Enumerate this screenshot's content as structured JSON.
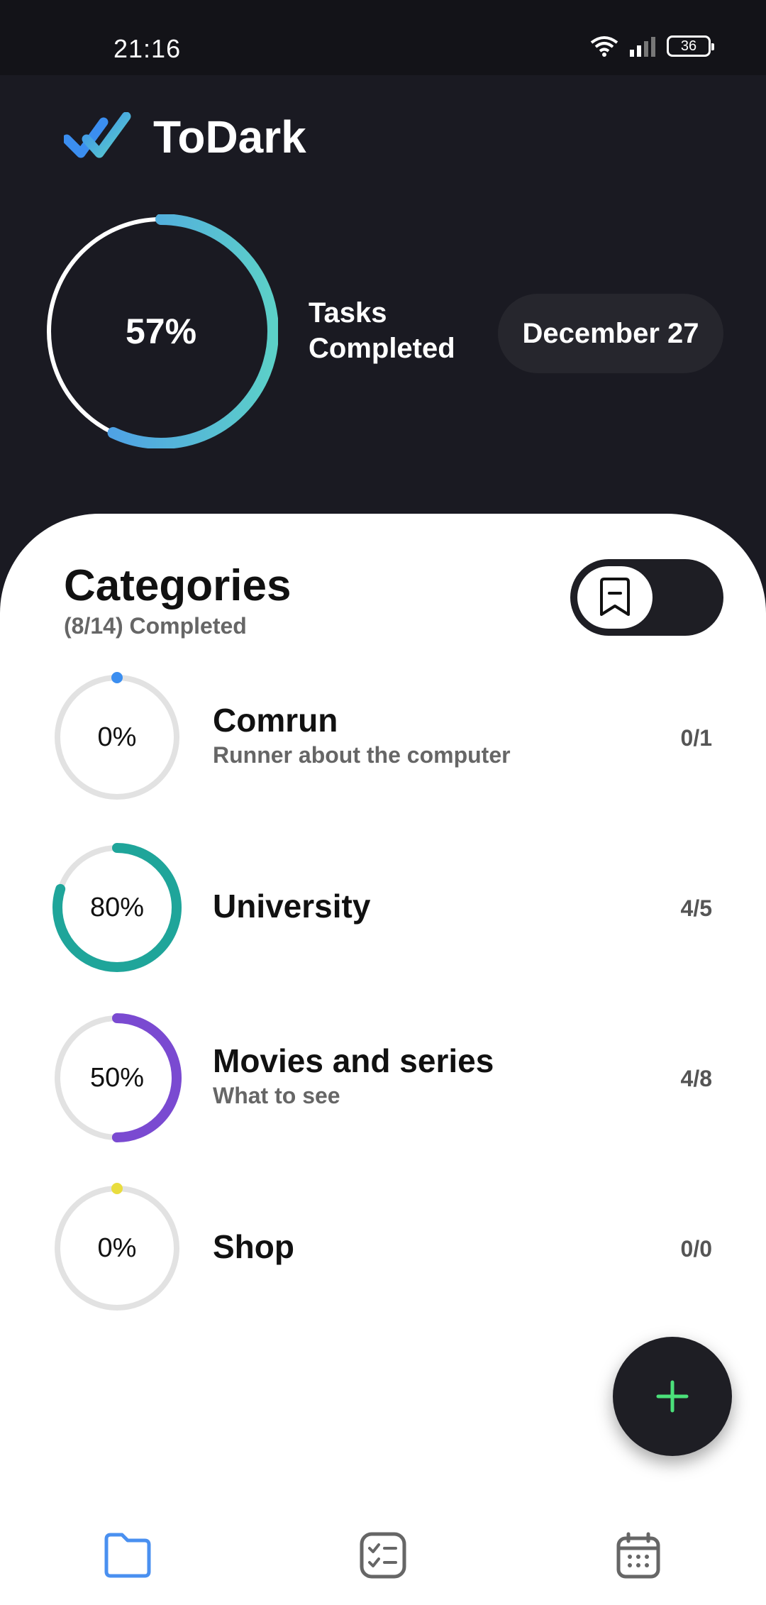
{
  "status_bar": {
    "time": "21:16",
    "battery": "36"
  },
  "app": {
    "title": "ToDark"
  },
  "summary": {
    "percent_label": "57%",
    "completed_fraction": 0.57,
    "tasks_label_1": "Tasks",
    "tasks_label_2": "Completed",
    "date": "December 27"
  },
  "categories": {
    "title": "Categories",
    "subtitle": "(8/14) Completed",
    "items": [
      {
        "name": "Comrun",
        "desc": "Runner about the computer",
        "percent_label": "0%",
        "fraction": 0,
        "count": "0/1",
        "color": "#3b8ef0"
      },
      {
        "name": "University",
        "desc": "",
        "percent_label": "80%",
        "fraction": 0.8,
        "count": "4/5",
        "color": "#1fa59a"
      },
      {
        "name": "Movies and series",
        "desc": "What to see",
        "percent_label": "50%",
        "fraction": 0.5,
        "count": "4/8",
        "color": "#7a4ad1"
      },
      {
        "name": "Shop",
        "desc": "",
        "percent_label": "0%",
        "fraction": 0,
        "count": "0/0",
        "color": "#e9dd3e"
      }
    ]
  },
  "bottom_nav": [
    {
      "icon": "folder-icon",
      "active": true
    },
    {
      "icon": "checklist-icon",
      "active": false
    },
    {
      "icon": "calendar-icon",
      "active": false
    }
  ],
  "colors": {
    "accent_blue": "#4a90f0",
    "accent_teal": "#5cd0c8",
    "fab_plus": "#4be07a"
  }
}
